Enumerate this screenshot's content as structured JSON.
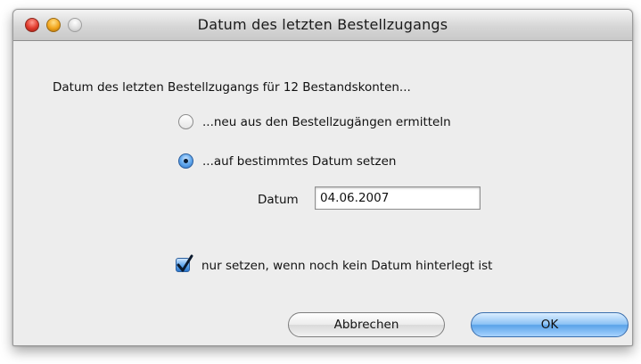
{
  "window": {
    "title": "Datum des letzten Bestellzugangs"
  },
  "dialog": {
    "prompt": "Datum des letzten Bestellzugangs für 12 Bestandskonten...",
    "options": [
      {
        "label": "...neu aus den Bestellzugängen ermitteln",
        "selected": false
      },
      {
        "label": "...auf bestimmtes Datum setzen",
        "selected": true
      }
    ],
    "date_label": "Datum",
    "date_value": "04.06.2007",
    "only_if_empty_label": "nur setzen, wenn noch kein Datum hinterlegt ist",
    "only_if_empty_checked": true,
    "cancel_label": "Abbrechen",
    "ok_label": "OK"
  },
  "colors": {
    "accent": "#5aa2e8",
    "close": "#e0392b",
    "minimize": "#f2a51c"
  },
  "icons": {
    "close": "close-icon",
    "minimize": "minimize-icon",
    "zoom": "zoom-icon",
    "check": "checkmark-icon"
  }
}
